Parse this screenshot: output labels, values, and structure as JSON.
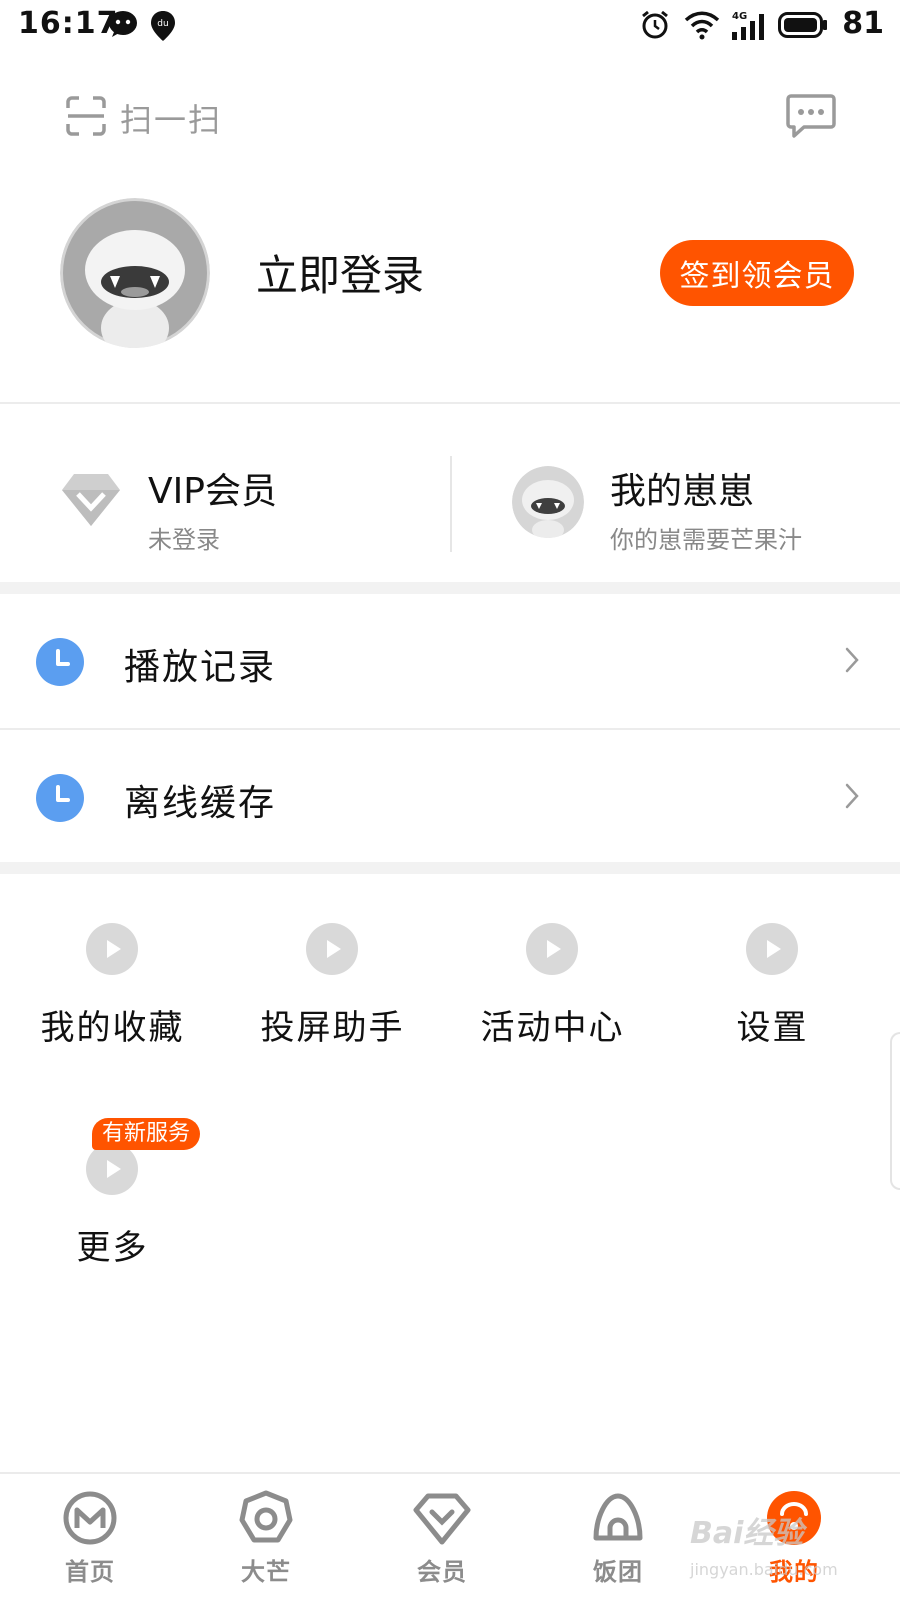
{
  "status_bar": {
    "time": "16:17",
    "battery": "81",
    "network": "4G",
    "app_badge": "du"
  },
  "top_bar": {
    "scan_label": "扫一扫"
  },
  "profile": {
    "login_label": "立即登录",
    "checkin_label": "签到领会员"
  },
  "member": {
    "vip_title": "VIP会员",
    "vip_sub": "未登录",
    "cub_title": "我的崽崽",
    "cub_sub": "你的崽需要芒果汁"
  },
  "list": [
    {
      "label": "播放记录",
      "icon": "clock-icon"
    },
    {
      "label": "离线缓存",
      "icon": "clock-icon"
    }
  ],
  "grid": [
    {
      "label": "我的收藏",
      "icon": "play-icon"
    },
    {
      "label": "投屏助手",
      "icon": "play-icon"
    },
    {
      "label": "活动中心",
      "icon": "play-icon"
    },
    {
      "label": "设置",
      "icon": "play-icon"
    },
    {
      "label": "更多",
      "icon": "play-icon",
      "badge": "有新服务"
    }
  ],
  "bottom_nav": [
    {
      "label": "首页",
      "icon": "home-mango-icon"
    },
    {
      "label": "大芒",
      "icon": "big-mango-icon"
    },
    {
      "label": "会员",
      "icon": "vip-icon"
    },
    {
      "label": "饭团",
      "icon": "fan-group-icon"
    },
    {
      "label": "我的",
      "icon": "mine-icon",
      "active": true
    }
  ],
  "watermark": {
    "main": "Bai经验",
    "sub": "jingyan.baidu.com"
  },
  "colors": {
    "accent": "#ff5400",
    "clock_blue": "#5b9ef0",
    "text_primary": "#111111",
    "text_secondary": "#888888",
    "icon_gray": "#d9d9d9"
  }
}
